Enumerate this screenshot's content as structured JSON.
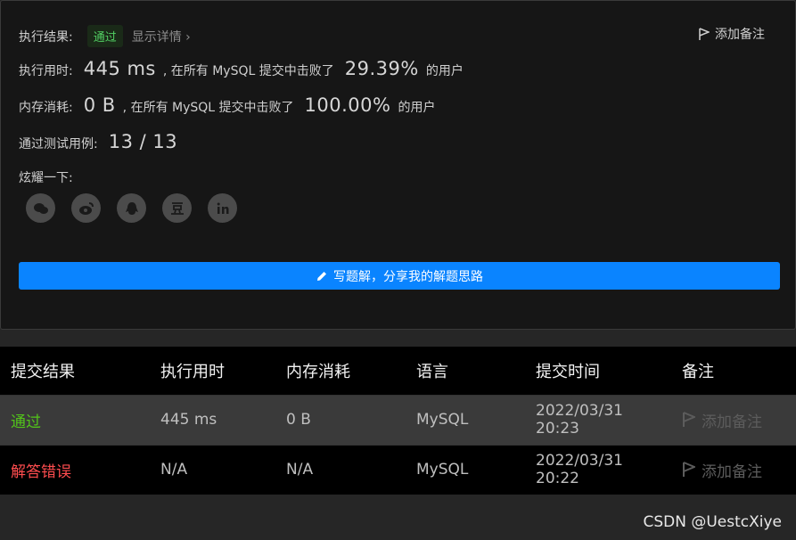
{
  "result": {
    "exec_result_label": "执行结果:",
    "status_badge": "通过",
    "show_details": "显示详情 ›",
    "add_note": "添加备注",
    "runtime_label": "执行用时:",
    "runtime_value": "445 ms",
    "runtime_prefix": ", 在所有 MySQL 提交中击败了",
    "runtime_percent": "29.39%",
    "runtime_suffix": "的用户",
    "memory_label": "内存消耗:",
    "memory_value": "0 B",
    "memory_prefix": ", 在所有 MySQL 提交中击败了",
    "memory_percent": "100.00%",
    "memory_suffix": "的用户",
    "tests_label": "通过测试用例:",
    "tests_value": "13 / 13",
    "share_label": "炫耀一下:",
    "share_icons": [
      "wechat-icon",
      "weibo-icon",
      "qq-icon",
      "douban-icon",
      "linkedin-icon"
    ],
    "write_solution": "写题解，分享我的解题思路"
  },
  "table": {
    "headers": [
      "提交结果",
      "执行用时",
      "内存消耗",
      "语言",
      "提交时间",
      "备注"
    ],
    "rows": [
      {
        "status": "通过",
        "time": "445 ms",
        "memory": "0 B",
        "lang": "MySQL",
        "submitted": "2022/03/31 20:23",
        "note": "添加备注"
      },
      {
        "status": "解答错误",
        "time": "N/A",
        "memory": "N/A",
        "lang": "MySQL",
        "submitted": "2022/03/31 20:22",
        "note": "添加备注"
      }
    ]
  },
  "watermark": "CSDN @UestcXiye",
  "colors": {
    "accent": "#0a84ff",
    "pass": "#52c41a",
    "fail": "#ff4d4f"
  }
}
